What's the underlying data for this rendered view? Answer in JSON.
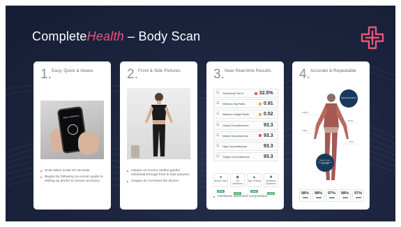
{
  "header": {
    "title_prefix": "Complete",
    "title_accent": "Health",
    "title_suffix": " – Body Scan"
  },
  "colors": {
    "background": "#1d2540",
    "accent": "#e8577a",
    "brand_navy": "#173a5c",
    "good": "#4caf6a"
  },
  "cards": [
    {
      "number": "1.",
      "heading": "Easy, Quick & Aware.",
      "phone_label": "Align Guidelines",
      "bullets": [
        "Scan takes under 60 seconds.",
        "Begins by following on-screen guide to setting up phone to ensure accuracy."
      ]
    },
    {
      "number": "2.",
      "heading": "Front & Side Pictures.",
      "bullets": [
        "Unique on-screen outline guides individual through front & side pictures.",
        "Images do not leave the device."
      ]
    },
    {
      "number": "3.",
      "heading": "Near Real-time Results.",
      "results": [
        {
          "label": "Total Body Fat %",
          "value": "32.5%",
          "color": "#f0544f"
        },
        {
          "label": "Waist-to-Hip Ratio",
          "value": "0.91",
          "color": "#f2a93b"
        },
        {
          "label": "Waist-to-Height Ratio",
          "value": "0.52",
          "color": "#f2a93b"
        },
        {
          "label": "Chest Circumference",
          "value": "93.3",
          "color": ""
        },
        {
          "label": "Waist Circumference",
          "value": "93.3",
          "color": "#f0544f"
        },
        {
          "label": "Hips Circumference",
          "value": "93.3",
          "color": ""
        },
        {
          "label": "Thighs Circumference",
          "value": "93.3",
          "color": ""
        }
      ],
      "types": [
        {
          "label": "Muscle Type",
          "badge": "HIGH"
        },
        {
          "label": "Fat Distribution",
          "badge": "HIGH"
        },
        {
          "label": "Type of Body",
          "badge": "HIGH"
        },
        {
          "label": "Metabolic Syndrome",
          "badge": "HIGH"
        }
      ],
      "bullets": [
        "Hardware optimized computation."
      ]
    },
    {
      "number": "4.",
      "heading": "Accurate & Repeatable",
      "badge_top": "Body fat Cohort",
      "badge_side": "Body fat Cohort accuracy compared with DEXA",
      "region_tags": [
        "CHEST",
        "WAIST",
        "THIGH",
        "HIPS"
      ],
      "percentages": [
        "98%",
        "98%",
        "97%",
        "98%",
        "97%"
      ]
    }
  ]
}
